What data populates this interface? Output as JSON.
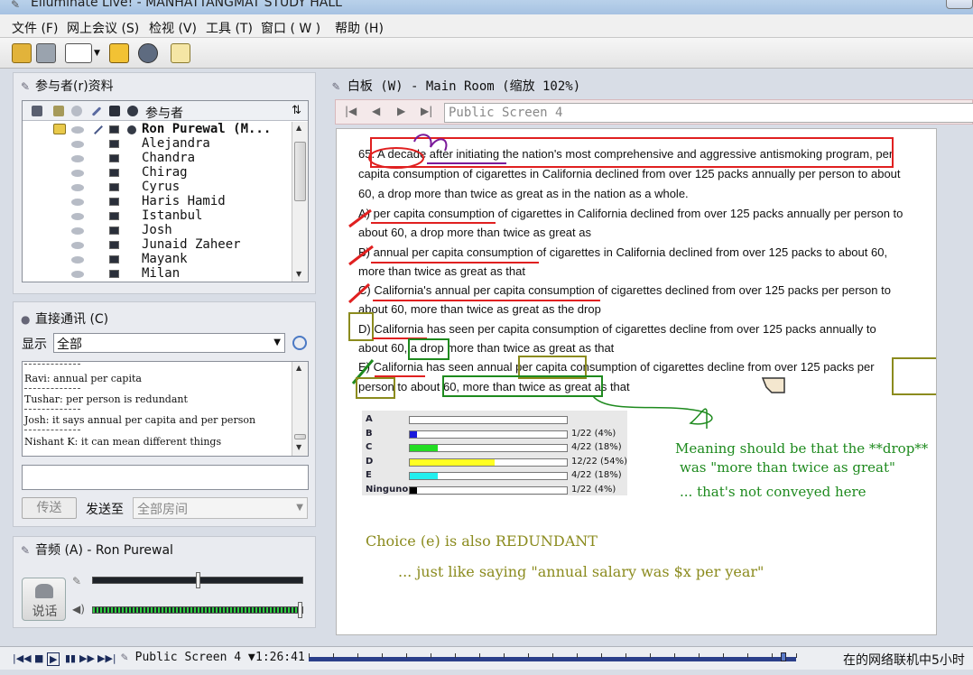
{
  "window": {
    "title": "Elluminate Live! - MANHATTANGMAT STUDY HALL"
  },
  "menu": [
    {
      "label": "文件 (F)"
    },
    {
      "label": "网上会议 (S)"
    },
    {
      "label": "检视 (V)"
    },
    {
      "label": "工具 (T)"
    },
    {
      "label": "窗口 ( W )"
    },
    {
      "label": "帮助 (H)"
    }
  ],
  "participants": {
    "title": "参与者(r)资料",
    "column_header": "参与者",
    "sort_symbol": "⇅",
    "list": [
      {
        "name": "Ron Purewal (M...",
        "moderator": true
      },
      {
        "name": "Alejandra"
      },
      {
        "name": "Chandra"
      },
      {
        "name": "Chirag"
      },
      {
        "name": "Cyrus"
      },
      {
        "name": "Haris Hamid"
      },
      {
        "name": "Istanbul"
      },
      {
        "name": "Josh"
      },
      {
        "name": "Junaid Zaheer"
      },
      {
        "name": "Mayank"
      },
      {
        "name": "Milan"
      }
    ]
  },
  "chat": {
    "title": "直接通讯 (C)",
    "display_label": "显示",
    "display_value": "全部",
    "messages": [
      {
        "text": "Ravi: annual per capita"
      },
      {
        "text": "Tushar: per person is redundant"
      },
      {
        "text": "Josh: it says annual per capita and per person"
      },
      {
        "text": "Nishant K: it can mean different things"
      }
    ],
    "send_label": "传送",
    "sendto_label": "发送至",
    "sendto_value": "全部房间"
  },
  "audio": {
    "title": "音频 (A) - Ron Purewal",
    "talk_label": "说话",
    "mic_volume": 0.5,
    "speaker_volume": 1.0
  },
  "whiteboard": {
    "title": "白板 (W) - Main Room (缩放 102%)",
    "screen_name": "Public Screen 4",
    "question_lines": [
      "65. A decade after initiating the nation's most comprehensive and aggressive antismoking program, per",
      "capita consumption of cigarettes in California declined from over 125 packs annually per person to about",
      "60, a drop more than twice as great as in the nation as a whole.",
      "A) per capita consumption of cigarettes in California declined from over 125 packs annually per person to",
      "about 60, a drop more than twice as great as",
      "B) annual per capita consumption of cigarettes in California declined from over 125 packs to about 60,",
      "more than twice as great as that",
      "C) California's annual per capita consumption of cigarettes declined from over 125 packs per person to",
      "about 60, more than twice as great as the drop",
      "D) California has seen per capita consumption of cigarettes decline from over 125 packs annually to",
      "about 60, a drop more than twice as great as that",
      "E) California has seen annual per capita consumption of cigarettes decline from over 125 packs per",
      "person to about 60, more than twice as great as that"
    ],
    "poll": [
      {
        "label": "A",
        "text": "",
        "fraction": 0,
        "color": "#ffffff"
      },
      {
        "label": "B",
        "text": "1/22 (4%)",
        "fraction": 0.045,
        "color": "#1a1adc"
      },
      {
        "label": "C",
        "text": "4/22 (18%)",
        "fraction": 0.18,
        "color": "#22dd22"
      },
      {
        "label": "D",
        "text": "12/22 (54%)",
        "fraction": 0.54,
        "color": "#ffff22"
      },
      {
        "label": "E",
        "text": "4/22 (18%)",
        "fraction": 0.18,
        "color": "#22eeee"
      },
      {
        "label": "Ninguno",
        "text": "1/22 (4%)",
        "fraction": 0.045,
        "color": "#000000"
      }
    ],
    "notes": {
      "green_1": "Meaning should be that the **drop**",
      "green_2": "was \"more than twice as great\"",
      "green_3": "... that's not conveyed here",
      "olive_1": "Choice (e) is also REDUNDANT",
      "olive_2": "... just like saying \"annual salary was $x per year\""
    }
  },
  "statusbar": {
    "screen_name": "Public Screen 4",
    "time": "1:26:41",
    "playback_position": 0.975,
    "status_text": "在的网络联机中5小时"
  }
}
